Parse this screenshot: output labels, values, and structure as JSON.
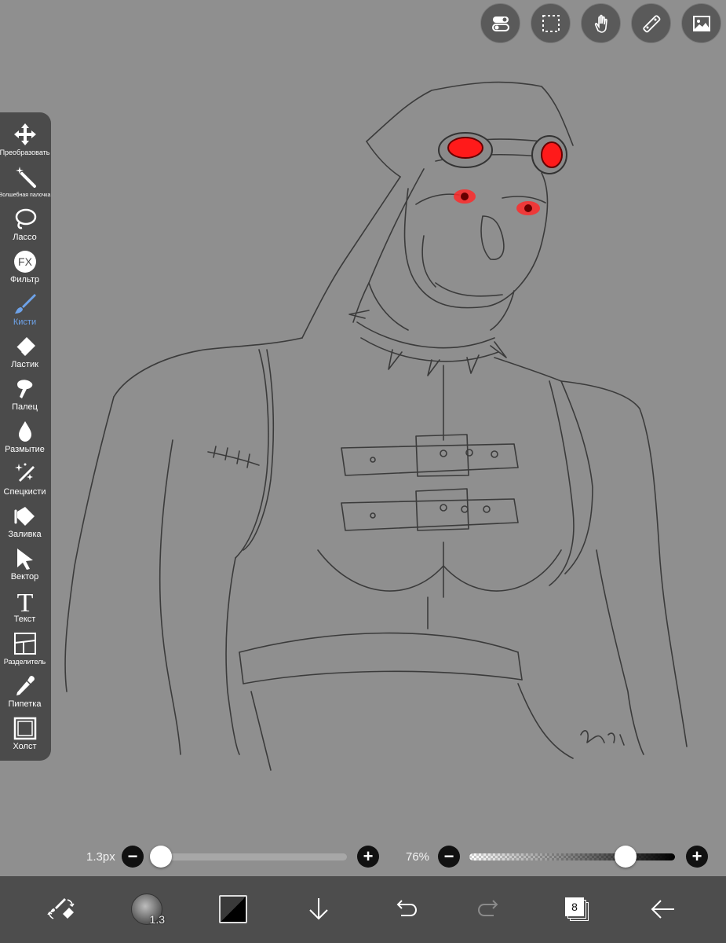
{
  "top_tools": [
    {
      "name": "toggle-icon"
    },
    {
      "name": "selection-icon"
    },
    {
      "name": "hand-icon"
    },
    {
      "name": "ruler-icon"
    },
    {
      "name": "image-icon"
    }
  ],
  "left_toolbar": {
    "items": [
      {
        "label": "Преобразовать",
        "icon": "move-icon"
      },
      {
        "label": "Волшебная палочка",
        "icon": "magic-wand-icon"
      },
      {
        "label": "Лассо",
        "icon": "lasso-icon"
      },
      {
        "label": "Фильтр",
        "icon": "fx-icon",
        "icon_text": "FX"
      },
      {
        "label": "Кисти",
        "icon": "brush-icon",
        "active": true
      },
      {
        "label": "Ластик",
        "icon": "eraser-icon"
      },
      {
        "label": "Палец",
        "icon": "smudge-icon"
      },
      {
        "label": "Размытие",
        "icon": "blur-icon"
      },
      {
        "label": "Спецкисти",
        "icon": "sparkle-brush-icon"
      },
      {
        "label": "Заливка",
        "icon": "fill-icon"
      },
      {
        "label": "Вектор",
        "icon": "vector-icon"
      },
      {
        "label": "Текст",
        "icon": "text-icon",
        "icon_text": "T"
      },
      {
        "label": "Разделитель",
        "icon": "divider-icon"
      },
      {
        "label": "Пипетка",
        "icon": "eyedropper-icon"
      },
      {
        "label": "Холст",
        "icon": "canvas-icon"
      }
    ]
  },
  "brush_size": {
    "value_label": "1.3px",
    "fraction": 0.05
  },
  "opacity": {
    "value_label": "76%",
    "fraction": 0.76
  },
  "bottom_bar": {
    "brush_size_label": "1.3",
    "layers_count": "8"
  },
  "colors": {
    "accent_active": "#6ea3ea",
    "toolbar_bg": "#4b4b4b",
    "canvas_bg": "#8f8f8f",
    "eye_glow": "#ff0000"
  }
}
